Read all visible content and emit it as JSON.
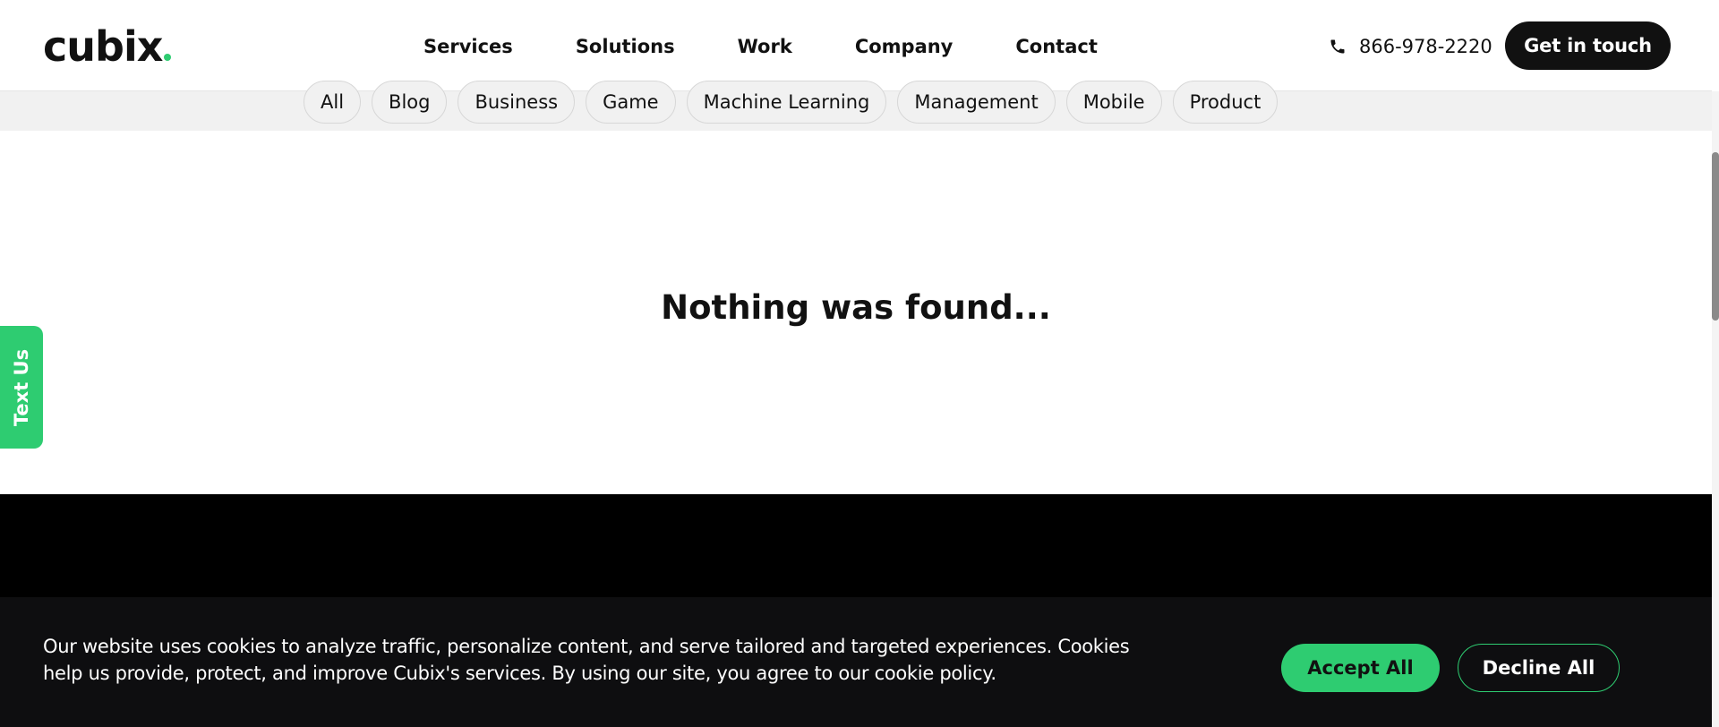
{
  "header": {
    "logo_text": "cubix",
    "accent_color": "#2ecc71",
    "nav": [
      {
        "label": "Services"
      },
      {
        "label": "Solutions"
      },
      {
        "label": "Work"
      },
      {
        "label": "Company"
      },
      {
        "label": "Contact"
      }
    ],
    "phone_icon": "phone-icon",
    "phone": "866-978-2220",
    "cta_label": "Get in touch"
  },
  "categories": [
    {
      "label": "All"
    },
    {
      "label": "Blog"
    },
    {
      "label": "Business"
    },
    {
      "label": "Game"
    },
    {
      "label": "Machine Learning"
    },
    {
      "label": "Management"
    },
    {
      "label": "Mobile"
    },
    {
      "label": "Product"
    }
  ],
  "main": {
    "empty_message": "Nothing was found..."
  },
  "side_tab": {
    "label": "Text Us"
  },
  "cookie_banner": {
    "text": "Our website uses cookies to analyze traffic, personalize content, and serve tailored and targeted experiences. Cookies help us provide, protect, and improve Cubix's services. By using our site, you agree to our cookie policy.",
    "accept_label": "Accept All",
    "decline_label": "Decline All"
  }
}
